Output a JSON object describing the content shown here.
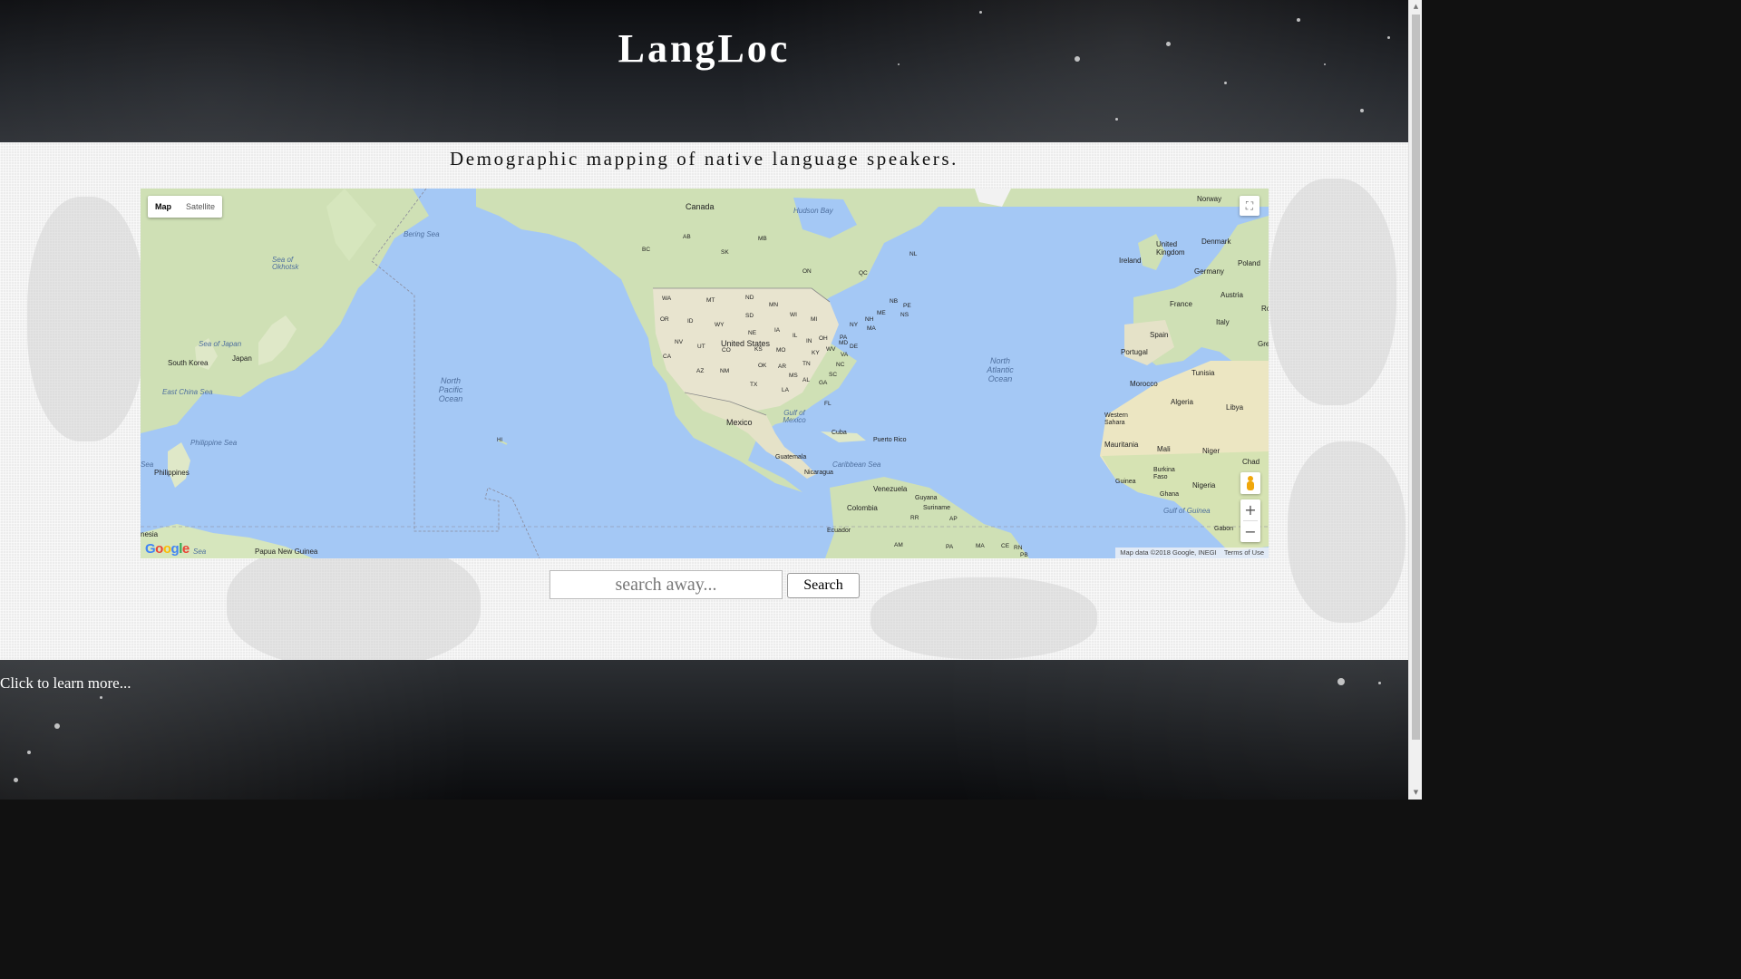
{
  "header": {
    "title": "LangLoc"
  },
  "tagline": "Demographic mapping of native language speakers.",
  "map": {
    "type_control": {
      "map_label": "Map",
      "satellite_label": "Satellite",
      "active": "Map"
    },
    "labels": {
      "canada": "Canada",
      "hudson_bay": "Hudson Bay",
      "norway": "Norway",
      "bering_sea": "Bering Sea",
      "sea_of_okhotsk": "Sea of Okhotsk",
      "uk": "United Kingdom",
      "denmark": "Denmark",
      "ireland": "Ireland",
      "germany": "Germany",
      "poland": "Poland",
      "france": "France",
      "austria": "Austria",
      "spain": "Spain",
      "italy": "Italy",
      "portugal": "Portugal",
      "tunisia": "Tunisia",
      "morocco": "Morocco",
      "algeria": "Algeria",
      "libya": "Libya",
      "western_sahara": "Western Sahara",
      "mauritania": "Mauritania",
      "mali": "Mali",
      "niger": "Niger",
      "chad": "Chad",
      "burkina_faso": "Burkina Faso",
      "guinea": "Guinea",
      "ghana": "Ghana",
      "nigeria": "Nigeria",
      "gulf_of_guinea": "Gulf of Guinea",
      "gabon": "Gabon",
      "united_states": "United States",
      "mexico": "Mexico",
      "gulf_of_mexico": "Gulf of Mexico",
      "cuba": "Cuba",
      "puerto_rico": "Puerto Rico",
      "caribbean_sea": "Caribbean Sea",
      "guatemala": "Guatemala",
      "nicaragua": "Nicaragua",
      "venezuela": "Venezuela",
      "guyana": "Guyana",
      "suriname": "Suriname",
      "colombia": "Colombia",
      "ecuador": "Ecuador",
      "north_pacific": "North Pacific Ocean",
      "north_atlantic": "North Atlantic Ocean",
      "sea_of_japan": "Sea of Japan",
      "south_korea": "South Korea",
      "japan": "Japan",
      "east_china_sea": "East China Sea",
      "philippine_sea": "Philippine Sea",
      "philippines": "Philippines",
      "papua_new_guinea": "Papua New Guinea",
      "nesia": "nesia",
      "hi": "HI",
      "bc": "BC",
      "ab": "AB",
      "sk": "SK",
      "mb": "MB",
      "on": "ON",
      "qc": "QC",
      "nl": "NL",
      "nb": "NB",
      "pe": "PE",
      "ns": "NS",
      "me": "ME",
      "wa": "WA",
      "mt": "MT",
      "nd": "ND",
      "mn": "MN",
      "or": "OR",
      "id": "ID",
      "wy": "WY",
      "sd": "SD",
      "wi": "WI",
      "mi": "MI",
      "ny": "NY",
      "nv": "NV",
      "ut": "UT",
      "ne": "NE",
      "ia": "IA",
      "il": "IL",
      "in": "IN",
      "oh": "OH",
      "pa": "PA",
      "ca": "CA",
      "co": "CO",
      "ks": "KS",
      "mo": "MO",
      "ky": "KY",
      "wv": "WV",
      "va": "VA",
      "md": "MD",
      "de": "DE",
      "nh": "NH",
      "ma": "MA",
      "az": "AZ",
      "nm": "NM",
      "ok": "OK",
      "ar": "AR",
      "tn": "TN",
      "nc": "NC",
      "tx": "TX",
      "ms": "MS",
      "al": "AL",
      "ga": "GA",
      "sc": "SC",
      "la": "LA",
      "fl": "FL",
      "rr": "RR",
      "ap": "AP",
      "am": "AM",
      "pa_br": "PA",
      "ma_br": "MA",
      "ce": "CE",
      "rn": "RN",
      "pb": "PB",
      "sea_label": "Sea",
      "sea_small": "Sea",
      "rc": "Ro",
      "gre": "Gre"
    },
    "google_logo": "Google",
    "attribution": "Map data ©2018 Google, INEGI",
    "terms": "Terms of Use",
    "zoom_in": "+",
    "zoom_out": "−",
    "fullscreen_icon": "⛶"
  },
  "search": {
    "placeholder": "search away...",
    "value": "",
    "button_label": "Search"
  },
  "footer": {
    "learn_more": "Click to learn more..."
  }
}
